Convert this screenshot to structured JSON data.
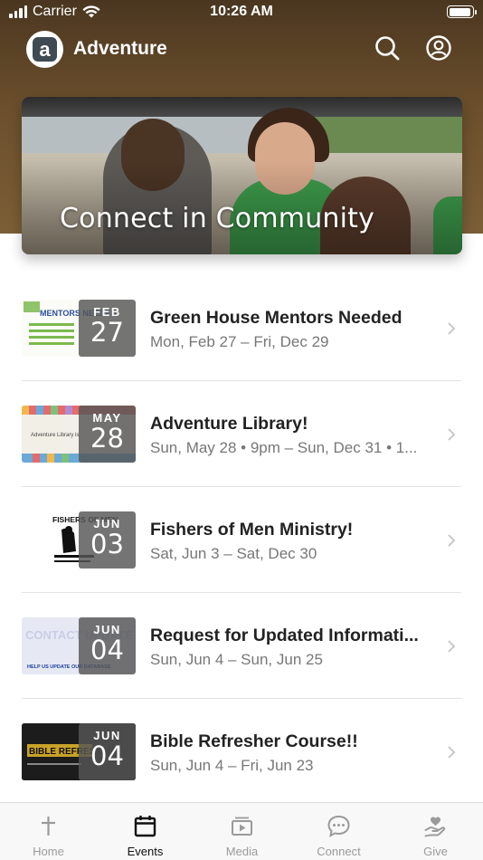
{
  "status_bar": {
    "carrier": "Carrier",
    "time": "10:26 AM"
  },
  "app_bar": {
    "title": "Adventure",
    "logo_letter": "a"
  },
  "hero": {
    "title": "Connect in Community"
  },
  "events": [
    {
      "title": "Green House Mentors Needed",
      "date": "Mon, Feb 27 – Fri, Dec 29",
      "month": "FEB",
      "day": "27",
      "thumb_text": "MENTORS NEEDED"
    },
    {
      "title": "Adventure Library!",
      "date": "Sun, May 28 • 9pm – Sun, Dec 31 • 1...",
      "month": "MAY",
      "day": "28",
      "thumb_text": "Adventure Library is"
    },
    {
      "title": "Fishers of Men Ministry!",
      "date": "Sat, Jun 3 – Sat, Dec 30",
      "month": "JUN",
      "day": "03",
      "thumb_text": "FISHERS OF MEN"
    },
    {
      "title": "Request for Updated Informati...",
      "date": "Sun, Jun 4 – Sun, Jun 25",
      "month": "JUN",
      "day": "04",
      "thumb_text": "CONTACT UPDATE",
      "thumb_subtext": "HELP US UPDATE OUR DATABASE"
    },
    {
      "title": "Bible Refresher Course!!",
      "date": "Sun, Jun 4 – Fri, Jun 23",
      "month": "JUN",
      "day": "04",
      "thumb_text": "BIBLE REFRESHER"
    }
  ],
  "tabs": [
    {
      "label": "Home",
      "icon": "cross-icon",
      "active": false
    },
    {
      "label": "Events",
      "icon": "calendar-icon",
      "active": true
    },
    {
      "label": "Media",
      "icon": "media-icon",
      "active": false
    },
    {
      "label": "Connect",
      "icon": "chat-icon",
      "active": false
    },
    {
      "label": "Give",
      "icon": "give-icon",
      "active": false
    }
  ],
  "colors": {
    "header": "#6b4f2c",
    "tab_active": "#111111",
    "tab_inactive": "#9a9a9a"
  }
}
